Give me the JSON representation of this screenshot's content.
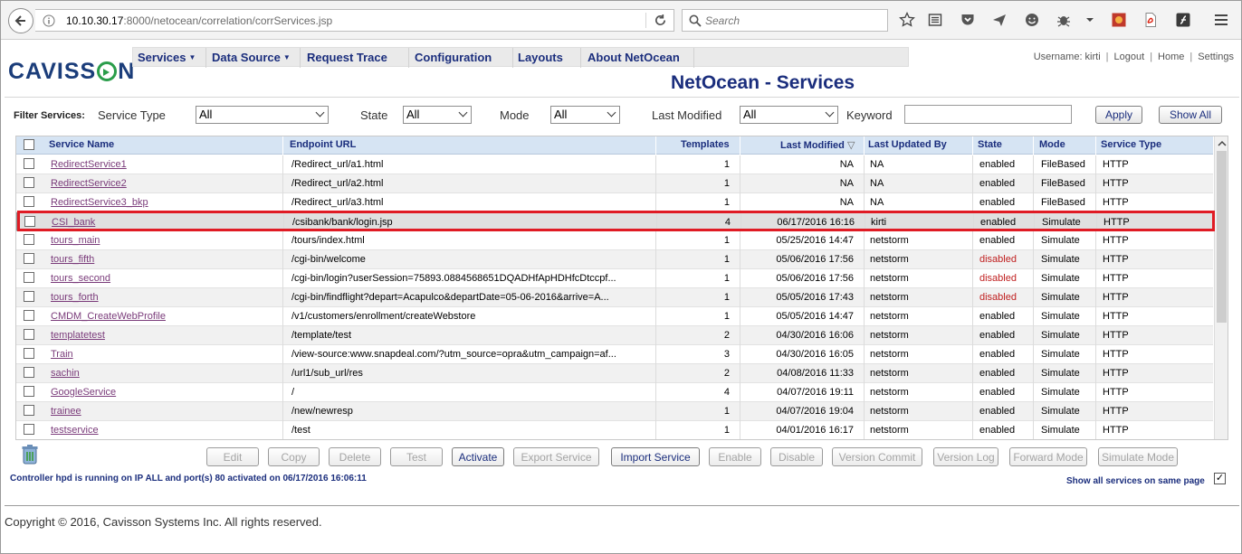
{
  "browser": {
    "url_host": "10.10.30.17",
    "url_rest": ":8000/netocean/correlation/corrServices.jsp",
    "search_placeholder": "Search"
  },
  "app": {
    "logo_text_1": "CAVISS",
    "logo_text_2": "N",
    "nav": [
      {
        "label": "Services",
        "has_caret": true
      },
      {
        "label": "Data Source",
        "has_caret": true
      },
      {
        "label": "Request Trace",
        "has_caret": false
      },
      {
        "label": "Configuration",
        "has_caret": false
      },
      {
        "label": "Layouts",
        "has_caret": false
      },
      {
        "label": "About NetOcean",
        "has_caret": false
      }
    ],
    "username_label": "Username: kirti",
    "logout": "Logout",
    "home": "Home",
    "settings": "Settings",
    "page_title": "NetOcean - Services"
  },
  "filter": {
    "label": "Filter Services:",
    "service_type_label": "Service Type",
    "service_type_value": "All",
    "state_label": "State",
    "state_value": "All",
    "mode_label": "Mode",
    "mode_value": "All",
    "last_modified_label": "Last Modified",
    "last_modified_value": "All",
    "keyword_label": "Keyword",
    "keyword_value": "",
    "apply": "Apply",
    "show_all": "Show All"
  },
  "table": {
    "headers": {
      "name": "Service Name",
      "url": "Endpoint URL",
      "templates": "Templates",
      "modified": "Last Modified",
      "sort_indicator": "▽",
      "updated_by": "Last Updated By",
      "state": "State",
      "mode": "Mode",
      "type": "Service Type"
    },
    "rows": [
      {
        "name": "RedirectService1",
        "url": "/Redirect_url/a1.html",
        "templates": "1",
        "modified": "NA",
        "updated_by": "NA",
        "state": "enabled",
        "mode": "FileBased",
        "type": "HTTP"
      },
      {
        "name": "RedirectService2",
        "url": "/Redirect_url/a2.html",
        "templates": "1",
        "modified": "NA",
        "updated_by": "NA",
        "state": "enabled",
        "mode": "FileBased",
        "type": "HTTP"
      },
      {
        "name": "RedirectService3_bkp",
        "url": "/Redirect_url/a3.html",
        "templates": "1",
        "modified": "NA",
        "updated_by": "NA",
        "state": "enabled",
        "mode": "FileBased",
        "type": "HTTP"
      },
      {
        "name": "CSI_bank",
        "url": "/csibank/bank/login.jsp",
        "templates": "4",
        "modified": "06/17/2016 16:16",
        "updated_by": "kirti",
        "state": "enabled",
        "mode": "Simulate",
        "type": "HTTP"
      },
      {
        "name": "tours_main",
        "url": "/tours/index.html",
        "templates": "1",
        "modified": "05/25/2016 14:47",
        "updated_by": "netstorm",
        "state": "enabled",
        "mode": "Simulate",
        "type": "HTTP"
      },
      {
        "name": "tours_fifth",
        "url": "/cgi-bin/welcome",
        "templates": "1",
        "modified": "05/06/2016 17:56",
        "updated_by": "netstorm",
        "state": "disabled",
        "mode": "Simulate",
        "type": "HTTP"
      },
      {
        "name": "tours_second",
        "url": "/cgi-bin/login?userSession=75893.0884568651DQADHfApHDHfcDtccpf...",
        "templates": "1",
        "modified": "05/06/2016 17:56",
        "updated_by": "netstorm",
        "state": "disabled",
        "mode": "Simulate",
        "type": "HTTP"
      },
      {
        "name": "tours_forth",
        "url": "/cgi-bin/findflight?depart=Acapulco&departDate=05-06-2016&arrive=A...",
        "templates": "1",
        "modified": "05/05/2016 17:43",
        "updated_by": "netstorm",
        "state": "disabled",
        "mode": "Simulate",
        "type": "HTTP"
      },
      {
        "name": "CMDM_CreateWebProfile",
        "url": "/v1/customers/enrollment/createWebstore",
        "templates": "1",
        "modified": "05/05/2016 14:47",
        "updated_by": "netstorm",
        "state": "enabled",
        "mode": "Simulate",
        "type": "HTTP"
      },
      {
        "name": "templatetest",
        "url": "/template/test",
        "templates": "2",
        "modified": "04/30/2016 16:06",
        "updated_by": "netstorm",
        "state": "enabled",
        "mode": "Simulate",
        "type": "HTTP"
      },
      {
        "name": "Train",
        "url": "/view-source:www.snapdeal.com/?utm_source=opra&utm_campaign=af...",
        "templates": "3",
        "modified": "04/30/2016 16:05",
        "updated_by": "netstorm",
        "state": "enabled",
        "mode": "Simulate",
        "type": "HTTP"
      },
      {
        "name": "sachin",
        "url": "/url1/sub_url/res",
        "templates": "2",
        "modified": "04/08/2016 11:33",
        "updated_by": "netstorm",
        "state": "enabled",
        "mode": "Simulate",
        "type": "HTTP"
      },
      {
        "name": "GoogleService",
        "url": "/",
        "templates": "4",
        "modified": "04/07/2016 19:11",
        "updated_by": "netstorm",
        "state": "enabled",
        "mode": "Simulate",
        "type": "HTTP"
      },
      {
        "name": "trainee",
        "url": "/new/newresp",
        "templates": "1",
        "modified": "04/07/2016 19:04",
        "updated_by": "netstorm",
        "state": "enabled",
        "mode": "Simulate",
        "type": "HTTP"
      },
      {
        "name": "testservice",
        "url": "/test",
        "templates": "1",
        "modified": "04/01/2016 16:17",
        "updated_by": "netstorm",
        "state": "enabled",
        "mode": "Simulate",
        "type": "HTTP"
      }
    ]
  },
  "actions": [
    {
      "label": "Edit",
      "enabled": false
    },
    {
      "label": "Copy",
      "enabled": false
    },
    {
      "label": "Delete",
      "enabled": false
    },
    {
      "label": "Test",
      "enabled": false
    },
    {
      "label": "Activate",
      "enabled": true
    },
    {
      "label": "Export Service",
      "enabled": false
    },
    {
      "label": "Import Service",
      "enabled": true
    },
    {
      "label": "Enable",
      "enabled": false
    },
    {
      "label": "Disable",
      "enabled": false
    },
    {
      "label": "Version Commit",
      "enabled": false
    },
    {
      "label": "Version Log",
      "enabled": false
    },
    {
      "label": "Forward Mode",
      "enabled": false
    },
    {
      "label": "Simulate Mode",
      "enabled": false
    }
  ],
  "status": {
    "controller": "Controller hpd is running on IP ALL and port(s) 80 activated on 06/17/2016 16:06:11",
    "show_all_same_page": "Show all services on same page",
    "show_all_checked": "✓"
  },
  "footer": {
    "copyright": "Copyright © 2016, Cavisson Systems Inc. All rights reserved."
  },
  "colors": {
    "brand": "#1b2e7d",
    "header_bg": "#d6e4f3",
    "highlight": "#e01b24",
    "disabled_state": "#c02020",
    "link": "#7a3b7a"
  }
}
